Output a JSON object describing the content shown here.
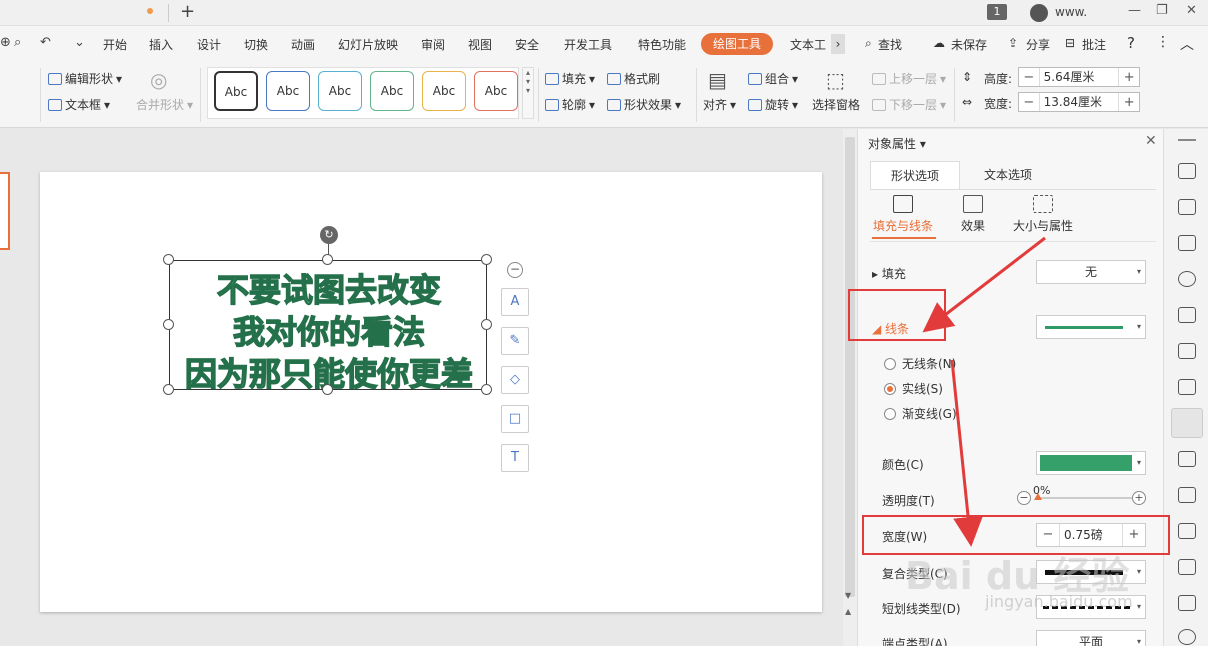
{
  "titlebar": {
    "new_tab": "+",
    "badge": "1",
    "user": "www.",
    "minimize": "—",
    "restore": "❐",
    "close": "✕"
  },
  "menu": {
    "items": [
      "开始",
      "插入",
      "设计",
      "切换",
      "动画",
      "幻灯片放映",
      "审阅",
      "视图",
      "安全",
      "开发工具",
      "特色功能"
    ],
    "active": "绘图工具",
    "text_tool": "文本工",
    "more": "›",
    "search": "查找",
    "unsaved": "未保存",
    "share": "分享",
    "comment": "批注",
    "help": "?",
    "more_dots": "⋮",
    "collapse": "︿"
  },
  "ribbon": {
    "edit_shape": "编辑形状",
    "text_box": "文本框",
    "merge_shape": "合并形状",
    "style_label": "Abc",
    "fill": "填充",
    "format_brush": "格式刷",
    "outline": "轮廓",
    "shape_effect": "形状效果",
    "align": "对齐",
    "group": "组合",
    "rotate": "旋转",
    "select_pane": "选择窗格",
    "bring_forward": "上移一层",
    "send_backward": "下移一层",
    "height_label": "高度:",
    "height_value": "5.64厘米",
    "width_label": "宽度:",
    "width_value": "13.84厘米",
    "minus": "−",
    "plus": "+"
  },
  "slide": {
    "lines": [
      "不要试图去改变",
      "我对你的看法",
      "因为那只能使你更差"
    ],
    "rotate_glyph": "↻",
    "collapse_glyph": "−"
  },
  "panel": {
    "title": "对象属性",
    "tab_shape": "形状选项",
    "tab_text": "文本选项",
    "sub_fill_line": "填充与线条",
    "sub_effect": "效果",
    "sub_size": "大小与属性",
    "fill_label": "填充",
    "fill_value": "无",
    "line_label": "线条",
    "no_line": "无线条(N)",
    "solid_line": "实线(S)",
    "gradient_line": "渐变线(G)",
    "color_label": "颜色(C)",
    "transparency_label": "透明度(T)",
    "transparency_value": "0%",
    "width_label": "宽度(W)",
    "width_value": "0.75磅",
    "compound_label": "复合类型(C)",
    "dash_label": "短划线类型(D)",
    "cap_label": "端点类型(A)",
    "cap_value": "平面",
    "line_color": "#2e9a66",
    "accent": "#e8703a"
  },
  "watermark": {
    "main": "Bai du 经验",
    "sub": "jingyan.baidu.com"
  }
}
